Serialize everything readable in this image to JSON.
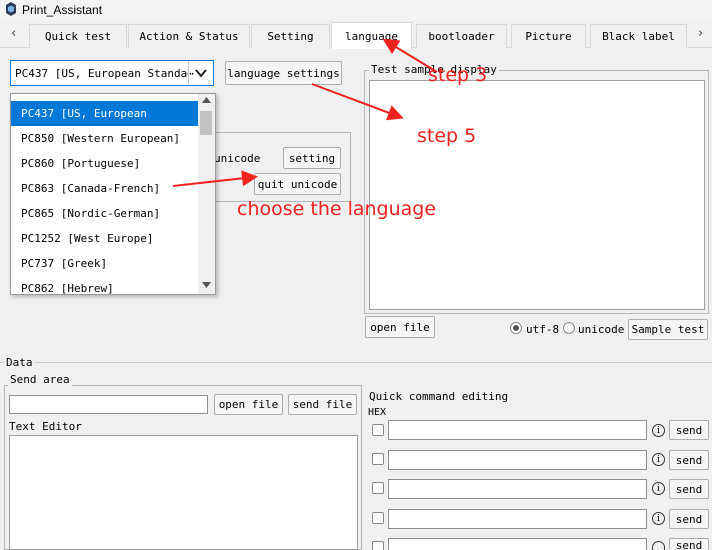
{
  "window": {
    "title": "Print_Assistant"
  },
  "tabs": [
    {
      "label": "Quick test"
    },
    {
      "label": "Action & Status"
    },
    {
      "label": "Setting"
    },
    {
      "label": "language"
    },
    {
      "label": "bootloader"
    },
    {
      "label": "Picture"
    },
    {
      "label": "Black label"
    }
  ],
  "language_panel": {
    "codepage_select_value": "PC437 [US, European Standa⋯",
    "language_settings_label": "language settings",
    "unicode_label": "unicode",
    "setting_label": "setting",
    "quit_unicode_label": "quit unicode",
    "codepage_options": [
      "PC437 [US, European",
      "PC850 [Western European]",
      "PC860 [Portuguese]",
      "PC863 [Canada-French]",
      "PC865 [Nordic-German]",
      "PC1252 [West Europe]",
      "PC737 [Greek]",
      "PC862 [Hebrew]"
    ],
    "selected_index": 0
  },
  "sample_panel": {
    "title": "Test sample display",
    "open_file_label": "open file",
    "encoding_options": [
      "utf-8",
      "unicode"
    ],
    "encoding_selected": "utf-8",
    "sample_test_label": "Sample test"
  },
  "data_section": {
    "title": "Data",
    "send_area_title": "Send area",
    "open_file_label": "open file",
    "send_file_label": "send file",
    "text_editor_label": "Text Editor",
    "quick_command_title": "Quick command editing",
    "hex_label": "HEX",
    "info_glyph": "i",
    "send_label": "send",
    "quick_commands": [
      {
        "value": "",
        "send": "send"
      },
      {
        "value": "",
        "send": "send"
      },
      {
        "value": "",
        "send": "send"
      },
      {
        "value": "",
        "send": "send"
      },
      {
        "value": "",
        "send": "send"
      }
    ]
  },
  "annotations": {
    "step3": "step 3",
    "step5": "step 5",
    "choose": "choose the language",
    "color": "#f0221f"
  },
  "colors": {
    "selection": "#0078d7",
    "window_bg": "#f0f0f0"
  }
}
